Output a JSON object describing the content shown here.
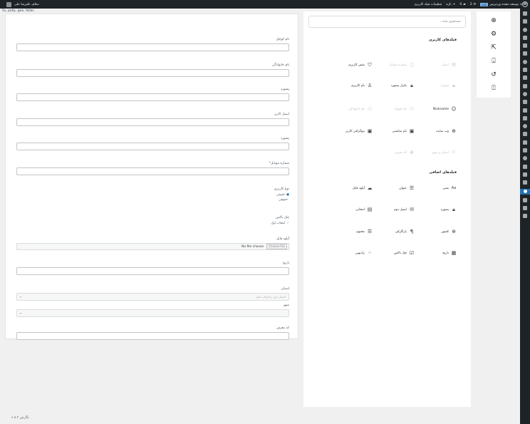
{
  "adminbar": {
    "site_title": "توسعه دهنده وردپرس",
    "site_tag": "خانه",
    "updates_count": "2",
    "comments_count": "0",
    "new_label": "تازه",
    "page_label": "تنظیمات فیلد کاربری",
    "user_greeting": "سلام، علیرضا علی"
  },
  "subline": "5s, polly, gee, fallac",
  "form": {
    "fields": [
      {
        "label": "نام کوچک"
      },
      {
        "label": "نام خانوادگی"
      },
      {
        "label": "پسورد"
      },
      {
        "label": "ایمیل کاربر"
      },
      {
        "label": "پسورد"
      },
      {
        "label": "شماره موبایل",
        "required": "*"
      },
      {
        "label": "نوع کاربری",
        "options": [
          "حقیقی",
          "حقوقی"
        ]
      },
      {
        "label": "چک باکس",
        "option": "انتخاب اول"
      },
      {
        "label": "آپلود فایل",
        "file_button": "Choose File",
        "file_status": "No file chosen"
      },
      {
        "label": "تاریخ"
      },
      {
        "label": "استان",
        "placeholder": "استان خود را انتخاب کنید",
        "arrow": "▾"
      },
      {
        "label": "شهر",
        "arrow": "▾"
      },
      {
        "label": "کد معرف"
      }
    ]
  },
  "picker": {
    "search_placeholder": "جستجوی فیلد...",
    "user_fields_title": "فیلدهای کاربری",
    "user_fields": [
      {
        "label": "ایمیل",
        "icon": "envelope-icon",
        "disabled": true
      },
      {
        "label": "شماره موبایل",
        "icon": "mobile-icon",
        "disabled": true
      },
      {
        "label": "نقش کاربری",
        "icon": "shield-icon",
        "disabled": false
      },
      {
        "label": "پسورد",
        "icon": "lock-icon",
        "disabled": true
      },
      {
        "label": "تکرار پسورد",
        "icon": "lock-icon",
        "disabled": false
      },
      {
        "label": "نام کاربری",
        "icon": "user-icon",
        "disabled": false
      },
      {
        "label": "Nickname",
        "icon": "smile-icon",
        "disabled": false
      },
      {
        "label": "نام کوچک",
        "icon": "user-group-icon",
        "disabled": true
      },
      {
        "label": "نام خانوادگی",
        "icon": "user-group-icon",
        "disabled": true
      },
      {
        "label": "وب سایت",
        "icon": "globe-icon",
        "disabled": false
      },
      {
        "label": "نام نمایشی",
        "icon": "id-card-icon",
        "disabled": false
      },
      {
        "label": "بیوگرافی کاربر",
        "icon": "id-card-icon",
        "disabled": false
      },
      {
        "label": "استان و شهر",
        "icon": "flag-icon",
        "disabled": true
      },
      {
        "label": "کد معرف",
        "icon": "globe-icon",
        "disabled": true
      }
    ],
    "extra_fields_title": "فیلدهای اضافی",
    "extra_fields": [
      {
        "label": "متنی",
        "icon": "text-icon"
      },
      {
        "label": "عنوان",
        "icon": "list-icon"
      },
      {
        "label": "آپلود فایل",
        "icon": "cloud-upload-icon"
      },
      {
        "label": "پسورد",
        "icon": "lock-icon"
      },
      {
        "label": "ایمیل دوم",
        "icon": "envelope-icon"
      },
      {
        "label": "انتخابی",
        "icon": "select-icon"
      },
      {
        "label": "کشور",
        "icon": "globe-icon"
      },
      {
        "label": "پاراگراف",
        "icon": "paragraph-icon"
      },
      {
        "label": "محتوی",
        "icon": "list-icon"
      },
      {
        "label": "تاریخ",
        "icon": "calendar-icon"
      },
      {
        "label": "چک باکس",
        "icon": "checkbox-icon"
      },
      {
        "label": "رادیویی",
        "icon": "radio-icon"
      }
    ]
  },
  "tools": [
    {
      "icon": "plus-circle-icon"
    },
    {
      "icon": "gear-icon"
    },
    {
      "icon": "external-link-icon"
    },
    {
      "icon": "import-icon"
    },
    {
      "icon": "reset-icon"
    },
    {
      "icon": "export-icon"
    }
  ],
  "footer": {
    "version": "نگارش ۶.۸.۲"
  }
}
